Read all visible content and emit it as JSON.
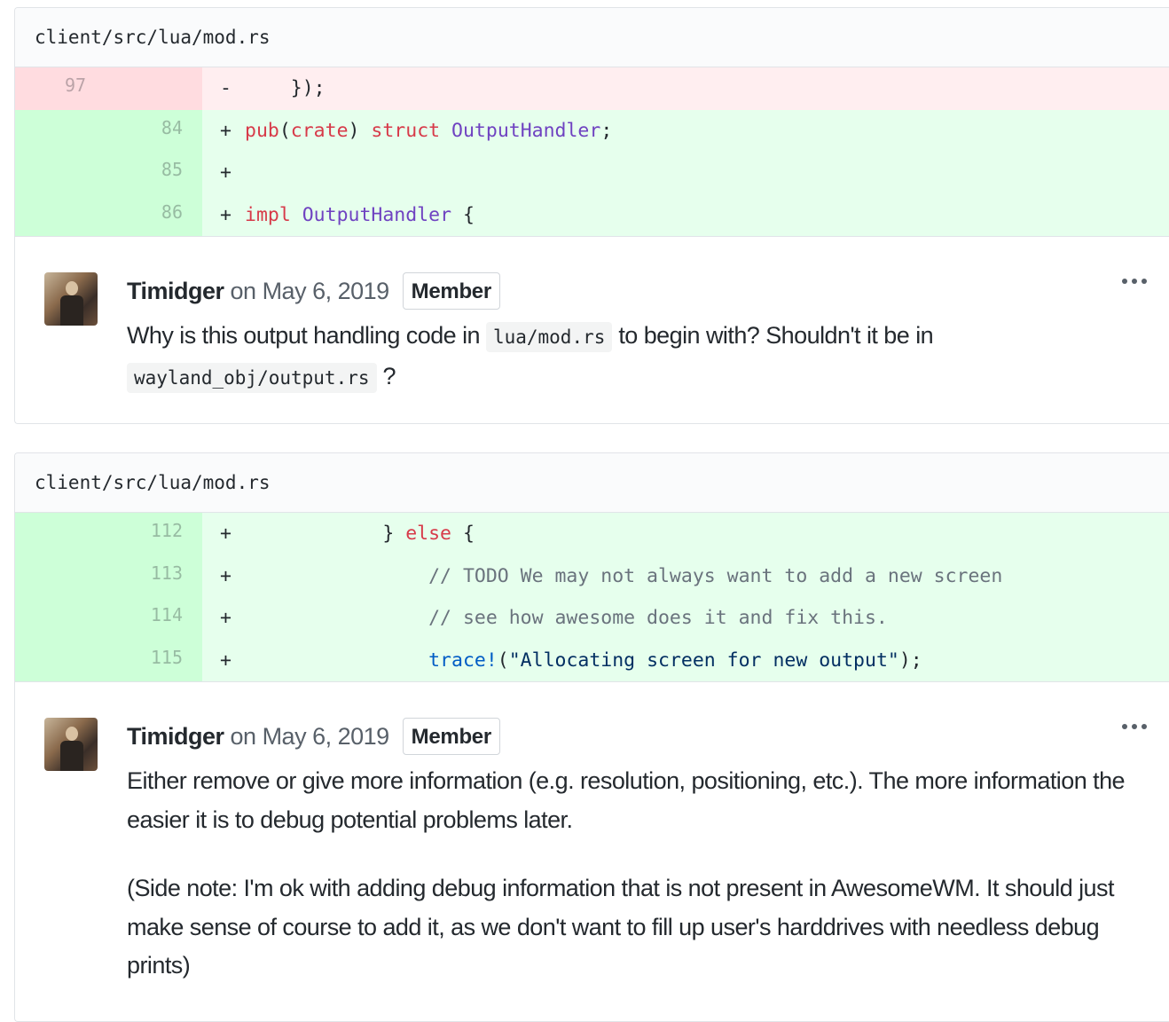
{
  "threads": [
    {
      "file_path": "client/src/lua/mod.rs",
      "diff_lines": [
        {
          "type": "del",
          "old_num": "97",
          "new_num": "",
          "marker": "-",
          "tokens": [
            {
              "t": "plain",
              "s": "    });"
            }
          ]
        },
        {
          "type": "add",
          "old_num": "",
          "new_num": "84",
          "marker": "+",
          "tokens": [
            {
              "t": "keyword",
              "s": "pub"
            },
            {
              "t": "plain",
              "s": "("
            },
            {
              "t": "keyword",
              "s": "crate"
            },
            {
              "t": "plain",
              "s": ") "
            },
            {
              "t": "keyword",
              "s": "struct"
            },
            {
              "t": "plain",
              "s": " "
            },
            {
              "t": "type",
              "s": "OutputHandler"
            },
            {
              "t": "plain",
              "s": ";"
            }
          ]
        },
        {
          "type": "add",
          "old_num": "",
          "new_num": "85",
          "marker": "+",
          "tokens": []
        },
        {
          "type": "add",
          "old_num": "",
          "new_num": "86",
          "marker": "+",
          "tokens": [
            {
              "t": "keyword",
              "s": "impl"
            },
            {
              "t": "plain",
              "s": " "
            },
            {
              "t": "type",
              "s": "OutputHandler"
            },
            {
              "t": "plain",
              "s": " {"
            }
          ]
        }
      ],
      "comment": {
        "author": "Timidger",
        "date": "on May 6, 2019",
        "badge": "Member",
        "paragraphs": [
          [
            {
              "t": "text",
              "s": "Why is this output handling code in "
            },
            {
              "t": "code",
              "s": "lua/mod.rs"
            },
            {
              "t": "text",
              "s": " to begin with? Shouldn't it be in "
            },
            {
              "t": "code",
              "s": "wayland_obj/output.rs"
            },
            {
              "t": "text",
              "s": " ?"
            }
          ]
        ]
      }
    },
    {
      "file_path": "client/src/lua/mod.rs",
      "diff_lines": [
        {
          "type": "add",
          "old_num": "",
          "new_num": "112",
          "marker": "+",
          "tokens": [
            {
              "t": "plain",
              "s": "            } "
            },
            {
              "t": "keyword",
              "s": "else"
            },
            {
              "t": "plain",
              "s": " {"
            }
          ]
        },
        {
          "type": "add",
          "old_num": "",
          "new_num": "113",
          "marker": "+",
          "tokens": [
            {
              "t": "comment",
              "s": "                // TODO We may not always want to add a new screen"
            }
          ]
        },
        {
          "type": "add",
          "old_num": "",
          "new_num": "114",
          "marker": "+",
          "tokens": [
            {
              "t": "comment",
              "s": "                // see how awesome does it and fix this."
            }
          ]
        },
        {
          "type": "add",
          "old_num": "",
          "new_num": "115",
          "marker": "+",
          "tokens": [
            {
              "t": "plain",
              "s": "                "
            },
            {
              "t": "macro",
              "s": "trace!"
            },
            {
              "t": "plain",
              "s": "("
            },
            {
              "t": "string",
              "s": "\"Allocating screen for new output\""
            },
            {
              "t": "plain",
              "s": ");"
            }
          ]
        }
      ],
      "comment": {
        "author": "Timidger",
        "date": "on May 6, 2019",
        "badge": "Member",
        "paragraphs": [
          [
            {
              "t": "text",
              "s": "Either remove or give more information (e.g. resolution, positioning, etc.). The more information the easier it is to debug potential problems later."
            }
          ],
          [
            {
              "t": "text",
              "s": "(Side note: I'm ok with adding debug information that is not present in AwesomeWM. It should just make sense of course to add it, as we don't want to fill up user's harddrives with needless debug prints)"
            }
          ]
        ]
      }
    }
  ]
}
